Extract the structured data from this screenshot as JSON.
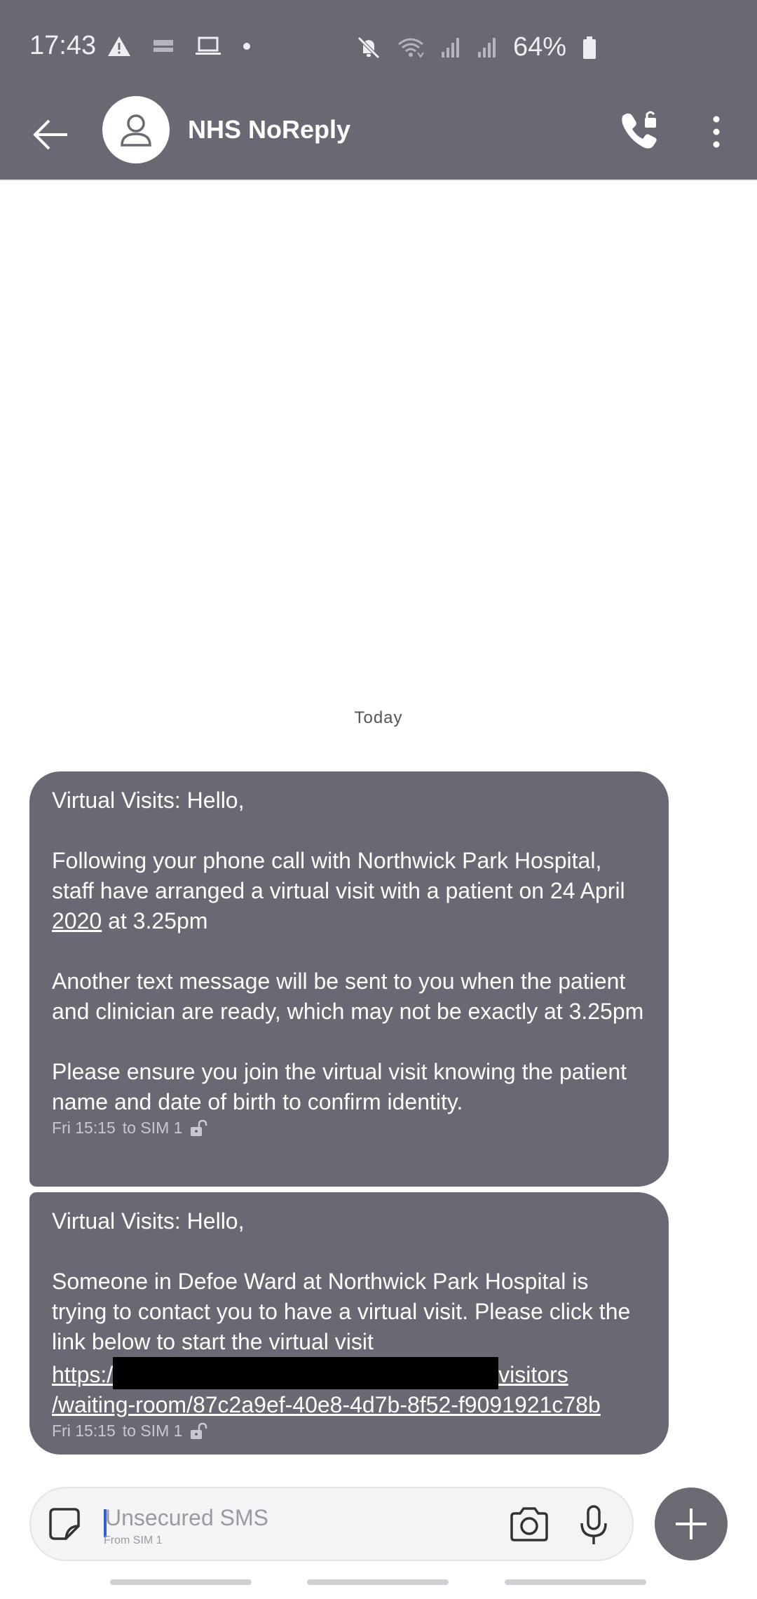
{
  "status_bar": {
    "time": "17:43",
    "battery": "64%",
    "icons": [
      "warning-icon",
      "news-icon",
      "laptop-icon",
      "dot-icon",
      "mute-icon",
      "wifi-icon",
      "signal-icon",
      "signal-icon",
      "battery-icon"
    ]
  },
  "header": {
    "title": "NHS NoReply",
    "icons": [
      "back-arrow-icon",
      "avatar-person-icon",
      "phone-call-icon",
      "more-vert-icon"
    ]
  },
  "conversation": {
    "date_separator": "Today",
    "messages": [
      {
        "heading": "Virtual Visits: Hello,",
        "para1_a": "Following your phone call with Northwick Park Hospital, staff have arranged a virtual visit with a patient on 24 April ",
        "para1_year": "2020",
        "para1_b": " at 3.25pm",
        "para2": "Another text message will be sent to you when the patient and clinician are ready, which may not be exactly at 3.25pm",
        "para3": "Please ensure you join the virtual visit knowing the patient name and date of birth to confirm identity.",
        "time": "Fri 15:15",
        "sim": "to SIM 1"
      },
      {
        "heading": "Virtual Visits: Hello,",
        "body": "Someone in Defoe Ward at Northwick Park Hospital is trying to contact you to have a virtual visit. Please click the link below to start the virtual visit",
        "link_start": "https:/",
        "link_mid": "visitors",
        "link_end": "/waiting-room/87c2a9ef-40e8-4d7b-8f52-f9091921c78b",
        "time": "Fri 15:15",
        "sim": "to SIM 1"
      }
    ]
  },
  "composer": {
    "placeholder": "Unsecured SMS",
    "sub_label": "From SIM 1"
  },
  "colors": {
    "bar": "#696873",
    "bubble": "#696873",
    "background": "#ffffff"
  }
}
